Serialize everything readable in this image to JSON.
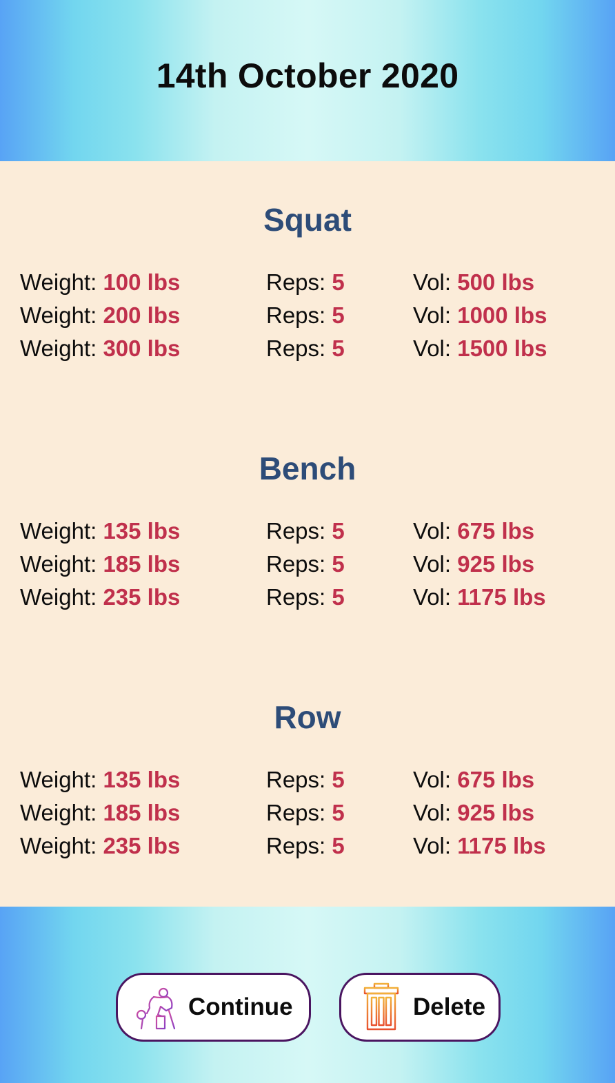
{
  "header": {
    "date": "14th October 2020"
  },
  "labels": {
    "weight": "Weight:",
    "reps": "Reps:",
    "vol": "Vol:"
  },
  "exercises": [
    {
      "name": "Squat",
      "sets": [
        {
          "weight": "100 lbs",
          "reps": "5",
          "vol": "500 lbs"
        },
        {
          "weight": "200 lbs",
          "reps": "5",
          "vol": "1000 lbs"
        },
        {
          "weight": "300 lbs",
          "reps": "5",
          "vol": "1500 lbs"
        }
      ]
    },
    {
      "name": "Bench",
      "sets": [
        {
          "weight": "135 lbs",
          "reps": "5",
          "vol": "675 lbs"
        },
        {
          "weight": "185 lbs",
          "reps": "5",
          "vol": "925 lbs"
        },
        {
          "weight": "235 lbs",
          "reps": "5",
          "vol": "1175 lbs"
        }
      ]
    },
    {
      "name": "Row",
      "sets": [
        {
          "weight": "135 lbs",
          "reps": "5",
          "vol": "675 lbs"
        },
        {
          "weight": "185 lbs",
          "reps": "5",
          "vol": "925 lbs"
        },
        {
          "weight": "235 lbs",
          "reps": "5",
          "vol": "1175 lbs"
        }
      ]
    }
  ],
  "footer": {
    "continue_label": "Continue",
    "continue_icon": "weightlifter-icon",
    "delete_label": "Delete",
    "delete_icon": "trash-can-icon"
  },
  "colors": {
    "title": "#0c0c0c",
    "exercise_name": "#2d4c78",
    "value": "#c0304c",
    "background": "#fbecd9",
    "button_border": "#4a1560"
  }
}
